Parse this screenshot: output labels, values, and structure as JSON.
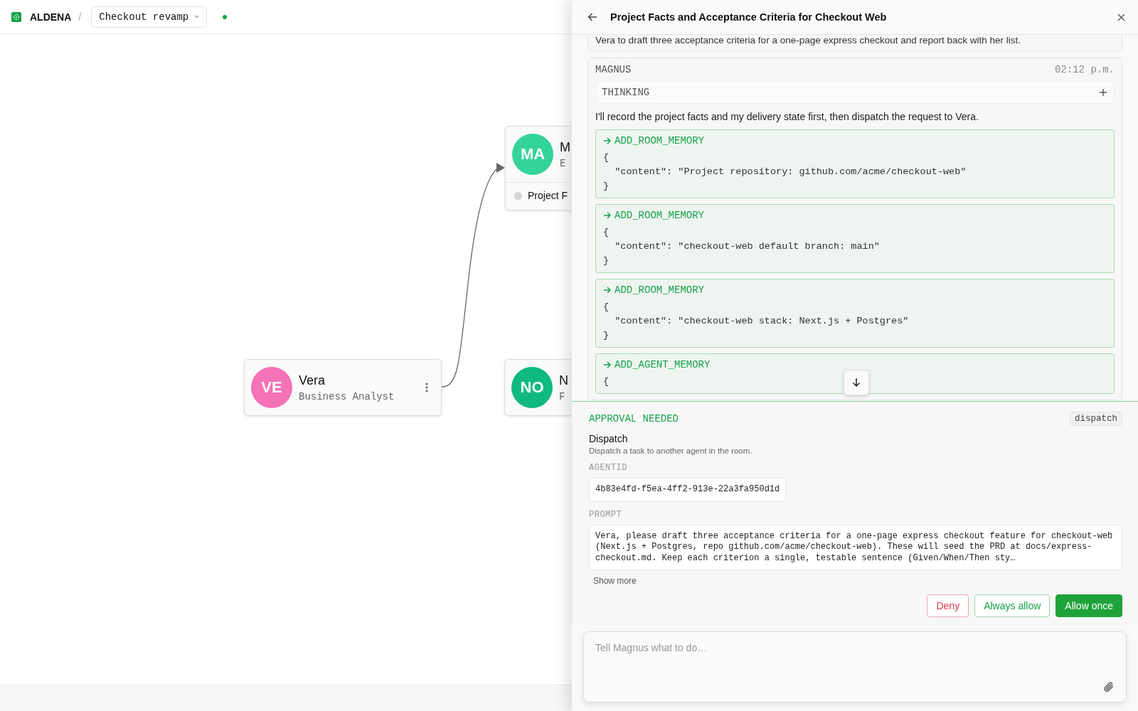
{
  "app": {
    "name": "ALDENA",
    "separator": "/",
    "project": "Checkout revamp",
    "connected": true
  },
  "canvas": {
    "nodes": [
      {
        "initials": "VE",
        "name": "Vera",
        "role": "Business Analyst",
        "color": "#f472b6",
        "menu": true
      },
      {
        "initials": "MA",
        "name": "M",
        "role": "E",
        "color": "#34d399",
        "task": {
          "label": "Project F",
          "active": false
        }
      },
      {
        "initials": "NO",
        "name": "N",
        "role": "F",
        "color": "#10b981"
      }
    ]
  },
  "panel": {
    "title": "Project Facts and Acceptance Criteria for Checkout Web",
    "messages": [
      {
        "kind": "note",
        "text": "Vera to draft three acceptance criteria for a one-page express checkout and report back with her list."
      },
      {
        "kind": "agent",
        "author": "MAGNUS",
        "time": "02:12 p.m.",
        "thinking": {
          "label": "THINKING",
          "expanded": false
        },
        "text": "I'll record the project facts and my delivery state first, then dispatch the request to Vera.",
        "tool_calls": [
          {
            "name": "ADD_ROOM_MEMORY",
            "body": [
              "{",
              "  \"content\": \"Project repository: github.com/acme/checkout-web\"",
              "}"
            ]
          },
          {
            "name": "ADD_ROOM_MEMORY",
            "body": [
              "{",
              "  \"content\": \"checkout-web default branch: main\"",
              "}"
            ]
          },
          {
            "name": "ADD_ROOM_MEMORY",
            "body": [
              "{",
              "  \"content\": \"checkout-web stack: Next.js + Postgres\"",
              "}"
            ]
          },
          {
            "name": "ADD_AGENT_MEMORY",
            "body": [
              "{"
            ]
          }
        ]
      }
    ],
    "approval": {
      "heading": "APPROVAL NEEDED",
      "tag": "dispatch",
      "tool": "Dispatch",
      "description": "Dispatch a task to another agent in the room.",
      "fields": [
        {
          "label": "AGENTID",
          "value": "4b83e4fd-f5ea-4ff2-913e-22a3fa950d1d",
          "kind": "inline"
        },
        {
          "label": "PROMPT",
          "value": "Vera, please draft three acceptance criteria for a one-page express checkout feature for checkout-web (Next.js + Postgres, repo github.com/acme/checkout-web). These will seed the PRD at docs/express-checkout.md. Keep each criterion a single, testable sentence (Given/When/Then sty…",
          "kind": "block"
        }
      ],
      "show_more": "Show more",
      "buttons": [
        {
          "label": "Deny",
          "kind": "deny"
        },
        {
          "label": "Always allow",
          "kind": "secondary"
        },
        {
          "label": "Allow once",
          "kind": "primary"
        }
      ]
    },
    "composer": {
      "placeholder": "Tell Magnus what to do…"
    }
  }
}
